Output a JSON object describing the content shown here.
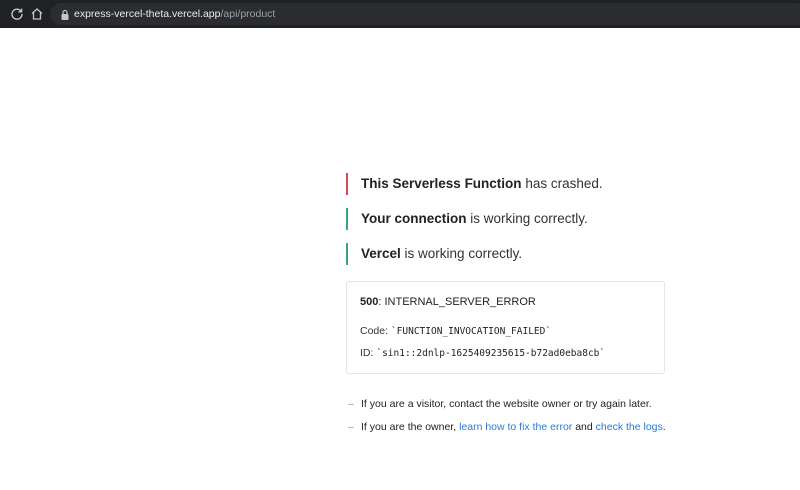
{
  "browser": {
    "url_host": "express-vercel-theta.vercel.app",
    "url_path": "/api/product",
    "icons": [
      "reload-icon",
      "home-icon",
      "lock-icon"
    ]
  },
  "status": [
    {
      "bold": "This Serverless Function",
      "rest": " has crashed.",
      "color": "#d0495a"
    },
    {
      "bold": "Your connection",
      "rest": " is working correctly.",
      "color": "#3ba37a"
    },
    {
      "bold": "Vercel",
      "rest": " is working correctly.",
      "color": "#3ba37a"
    }
  ],
  "error": {
    "code_number": "500",
    "code_text": ": INTERNAL_SERVER_ERROR",
    "code_label": "Code: ",
    "code_value": "`FUNCTION_INVOCATION_FAILED`",
    "id_label": "ID: ",
    "id_value": "`sin1::2dnlp-1625409235615-b72ad0eba8cb`"
  },
  "notes": {
    "visitor": "If you are a visitor, contact the website owner or try again later.",
    "owner_prefix": "If you are the owner, ",
    "owner_link1": "learn how to fix the error",
    "owner_mid": " and ",
    "owner_link2": "check the logs",
    "owner_suffix": ".",
    "dash": "–"
  }
}
